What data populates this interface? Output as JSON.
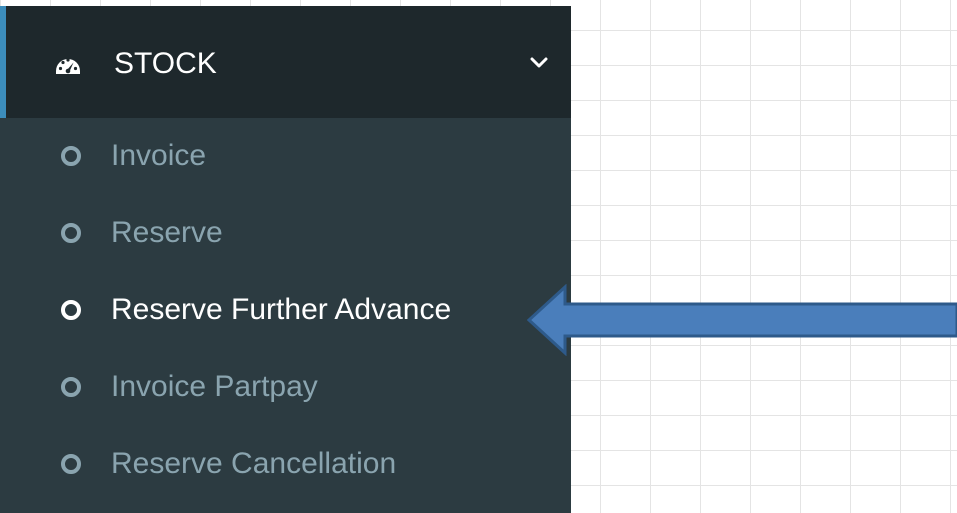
{
  "sidebar": {
    "header": {
      "icon": "dashboard-icon",
      "title": "STOCK",
      "toggle_icon": "chevron-down-icon"
    },
    "items": [
      {
        "label": "Invoice",
        "icon": "circle-icon",
        "active": false
      },
      {
        "label": "Reserve",
        "icon": "circle-icon",
        "active": false
      },
      {
        "label": "Reserve Further Advance",
        "icon": "circle-icon",
        "active": true
      },
      {
        "label": "Invoice Partpay",
        "icon": "circle-icon",
        "active": false
      },
      {
        "label": "Reserve Cancellation",
        "icon": "circle-icon",
        "active": false
      }
    ]
  },
  "annotation": {
    "icon": "left-arrow-icon",
    "fill_color": "#4a7ebb",
    "stroke_color": "#2e5a8a"
  },
  "colors": {
    "sidebar_bg": "#2c3b41",
    "header_bg": "#1e282c",
    "accent": "#3c8dbc",
    "item_text": "#8aa4af",
    "active_text": "#ffffff"
  }
}
